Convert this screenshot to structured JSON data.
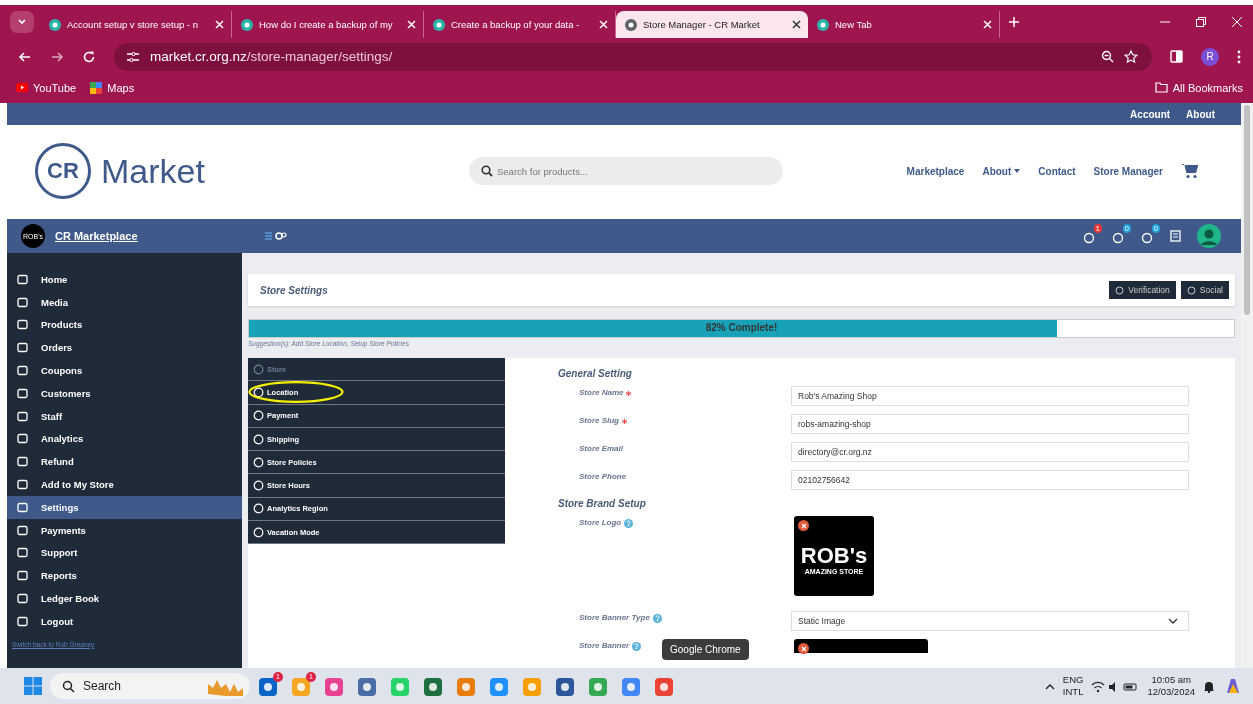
{
  "browser": {
    "tabs": [
      {
        "title": "Account setup v store setup - n",
        "selected": false
      },
      {
        "title": "How do I create a backup of my",
        "selected": false
      },
      {
        "title": "Create a backup of your data - ",
        "selected": false
      },
      {
        "title": "Store Manager - CR Market",
        "selected": true
      },
      {
        "title": "New Tab",
        "selected": false
      }
    ],
    "url_host": "market.cr.org.nz",
    "url_path": "/store-manager/settings/",
    "profile": "R",
    "bookmarks": [
      "YouTube",
      "Maps"
    ],
    "all_bookmarks": "All Bookmarks"
  },
  "site": {
    "top_links": [
      "Account",
      "About"
    ],
    "logo_mark": "CR",
    "logo_text": "Market",
    "search": {
      "placeholder": "Search for products..."
    },
    "nav": [
      {
        "label": "Marketplace",
        "dropdown": false
      },
      {
        "label": "About",
        "dropdown": true
      },
      {
        "label": "Contact",
        "dropdown": false
      },
      {
        "label": "Store Manager",
        "dropdown": false
      }
    ]
  },
  "dashboard": {
    "store_badge": "ROB's",
    "store_name": "CR Marketplace",
    "notifications": [
      "1",
      "0",
      "0"
    ]
  },
  "sidebar": {
    "items": [
      {
        "label": "Home",
        "selected": false
      },
      {
        "label": "Media",
        "selected": false
      },
      {
        "label": "Products",
        "selected": false
      },
      {
        "label": "Orders",
        "selected": false
      },
      {
        "label": "Coupons",
        "selected": false
      },
      {
        "label": "Customers",
        "selected": false
      },
      {
        "label": "Staff",
        "selected": false
      },
      {
        "label": "Analytics",
        "selected": false
      },
      {
        "label": "Refund",
        "selected": false
      },
      {
        "label": "Add to My Store",
        "selected": false
      },
      {
        "label": "Settings",
        "selected": true
      },
      {
        "label": "Payments",
        "selected": false
      },
      {
        "label": "Support",
        "selected": false
      },
      {
        "label": "Reports",
        "selected": false
      },
      {
        "label": "Ledger Book",
        "selected": false
      },
      {
        "label": "Logout",
        "selected": false
      }
    ],
    "switch_back": "Switch back to Rob Greaney"
  },
  "page": {
    "title": "Store Settings",
    "buttons": [
      "Verification",
      "Social"
    ],
    "progress": {
      "level": 0.82,
      "label": "82% Complete!"
    },
    "suggestion": "Suggestion(s): Add Store Location, Setup Store Policies",
    "menu": [
      {
        "label": "Store",
        "selected": true,
        "highlighted": false
      },
      {
        "label": "Location",
        "selected": false,
        "highlighted": true
      },
      {
        "label": "Payment",
        "selected": false,
        "highlighted": false
      },
      {
        "label": "Shipping",
        "selected": false,
        "highlighted": false
      },
      {
        "label": "Store Policies",
        "selected": false,
        "highlighted": false
      },
      {
        "label": "Store Hours",
        "selected": false,
        "highlighted": false
      },
      {
        "label": "Analytics Region",
        "selected": false,
        "highlighted": false
      },
      {
        "label": "Vacation Mode",
        "selected": false,
        "highlighted": false
      }
    ],
    "sections": [
      {
        "title": "General Setting",
        "fields": [
          {
            "label": "Store Name",
            "kind": "text",
            "required": true,
            "help": false,
            "value": "Rob's Amazing Shop"
          },
          {
            "label": "Store Slug",
            "kind": "text",
            "required": true,
            "help": false,
            "value": "robs-amazing-shop"
          },
          {
            "label": "Store Email",
            "kind": "text",
            "required": false,
            "help": false,
            "value": "directory@cr.org.nz"
          },
          {
            "label": "Store Phone",
            "kind": "text",
            "required": false,
            "help": false,
            "value": "02102756642"
          }
        ]
      },
      {
        "title": "Store Brand Setup",
        "fields": [
          {
            "label": "Store Logo",
            "kind": "logo",
            "required": false,
            "help": true,
            "logo_text": "ROB's",
            "logo_subtext": "AMAZING STORE"
          },
          {
            "label": "Store Banner Type",
            "kind": "select",
            "required": false,
            "help": true,
            "value": "Static Image"
          },
          {
            "label": "Store Banner",
            "kind": "banner",
            "required": false,
            "help": true
          }
        ]
      }
    ]
  },
  "tooltip": "Google Chrome",
  "taskbar": {
    "search": "Search",
    "badges": [
      "1",
      "1"
    ],
    "language": "ENG",
    "layout": "INTL",
    "time": "10:05 am",
    "date": "12/03/2024"
  }
}
